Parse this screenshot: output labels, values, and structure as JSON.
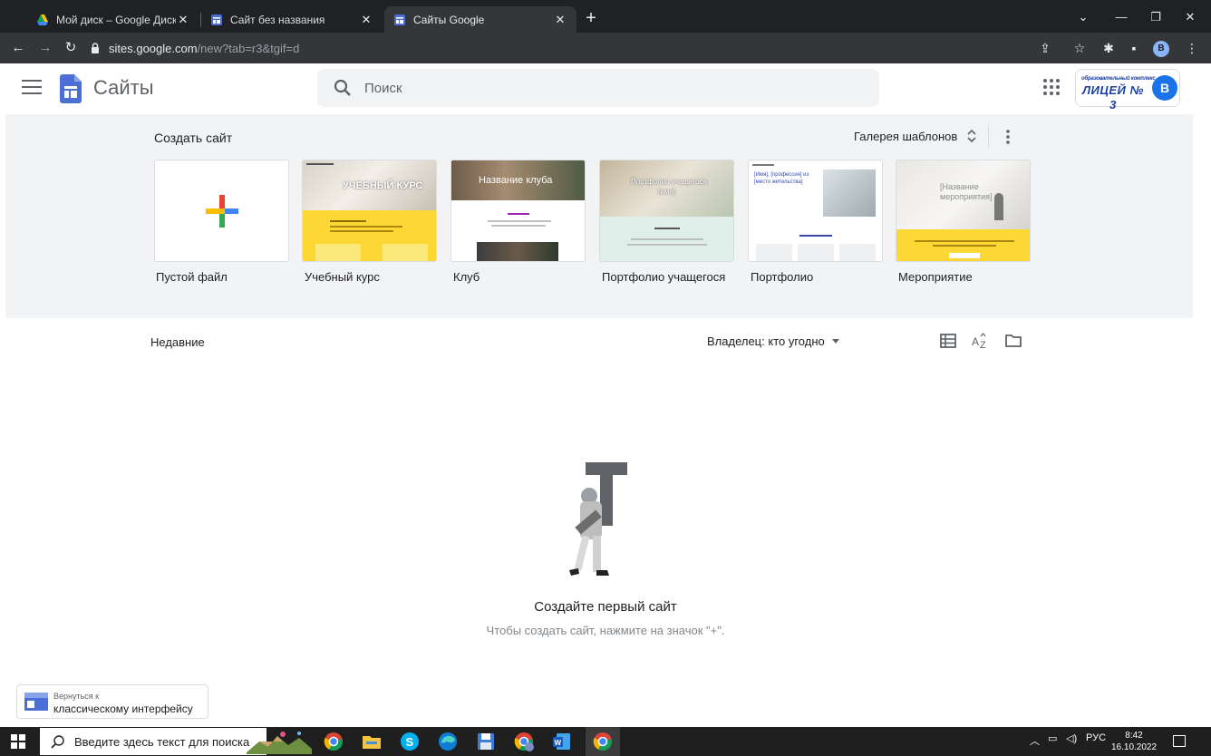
{
  "browser": {
    "tabs": [
      {
        "title": "Мой диск – Google Диск"
      },
      {
        "title": "Сайт без названия"
      },
      {
        "title": "Сайты Google"
      }
    ],
    "address_host": "sites.google.com",
    "address_path": "/new?tab=r3&tgif=d",
    "profile_letter": "B"
  },
  "header": {
    "app_title": "Сайты",
    "search_placeholder": "Поиск",
    "org_logo_top": "образовательный комплекс",
    "org_logo_main": "ЛИЦЕЙ № 3",
    "avatar_letter": "B"
  },
  "gallery": {
    "title": "Создать сайт",
    "gallery_button": "Галерея шаблонов",
    "templates": [
      {
        "label": "Пустой файл"
      },
      {
        "label": "Учебный курс",
        "thumb_title": "УЧЕБНЫЙ КУРС"
      },
      {
        "label": "Клуб",
        "thumb_title": "Название клуба"
      },
      {
        "label": "Портфолио учащегося",
        "thumb_title": "Портфолио учащегося",
        "thumb_sub": "[имя]"
      },
      {
        "label": "Портфолио",
        "thumb_title": "[Имя], [профессия] из [место жительства]"
      },
      {
        "label": "Мероприятие",
        "thumb_title": "[Название мероприятия]"
      }
    ]
  },
  "recent": {
    "title": "Недавние",
    "owner_filter": "Владелец: кто угодно",
    "empty_title": "Создайте первый сайт",
    "empty_subtitle": "Чтобы создать сайт, нажмите на значок \"+\"."
  },
  "classic": {
    "line1": "Вернуться к",
    "line2": "классическому интерфейсу"
  },
  "taskbar": {
    "search_placeholder": "Введите здесь текст для поиска",
    "lang": "РУС",
    "time": "8:42",
    "date": "16.10.2022"
  },
  "colors": {
    "brand_blue": "#1a73e8",
    "gallery_bg": "#f1f3f4",
    "template_yellow": "#fdd835"
  }
}
